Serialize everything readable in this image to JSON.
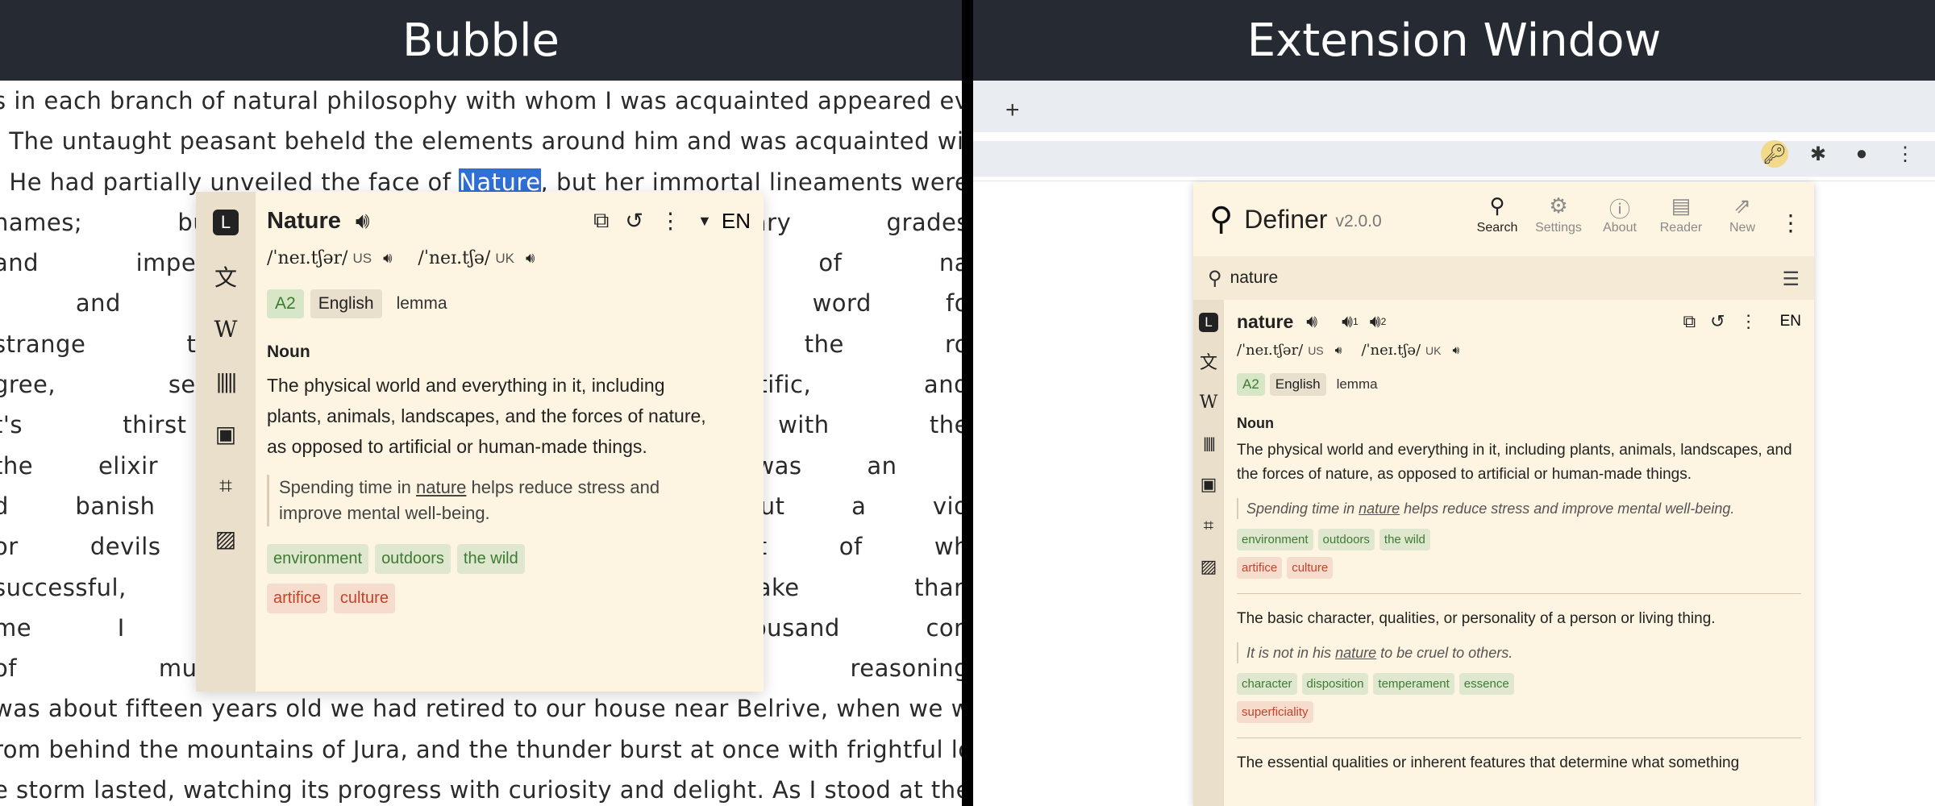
{
  "left_panel": {
    "title": "Bubble",
    "book_lines": [
      {
        "pre": "s in each branch of natural philosophy with whom I was acquainted appeared even",
        "word": "",
        "post": ""
      },
      {
        "pre": ". The untaught peasant beheld the elements around him and was acquainted with th",
        "word": "",
        "post": ""
      },
      {
        "pre": ". He had partially unveiled the face of ",
        "word": "Nature",
        "post": ", but her immortal lineaments were still"
      },
      {
        "pre": "names; but, not to",
        "word": "",
        "post": "                                                         nd tertiary grades"
      },
      {
        "pre": " and impediments",
        "word": "",
        "post": "                                                         g the citadel of na"
      },
      {
        "pre": ", and here were m",
        "word": "",
        "post": "                                                         took their word fo"
      },
      {
        "pre": "strange that such",
        "word": "",
        "post": "                                                         I followed the ro"
      },
      {
        "pre": "gree, self-taught w",
        "word": "",
        "post": "                                                         not scientific, and"
      },
      {
        "pre": "t's thirst for know",
        "word": "",
        "post": "                                                         entered with the"
      },
      {
        "pre": "the elixir of life; bu",
        "word": "",
        "post": "                                                         n. Wealth was an i"
      },
      {
        "pre": "d banish disease f",
        "word": "",
        "post": "                                                         le to any but a vid"
      },
      {
        "pre": "or devils was a pro",
        "word": "",
        "post": "                                                         he fulfilment of wh"
      },
      {
        "pre": "successful, I attrib",
        "word": "",
        "post": "                                                         and mistake than"
      },
      {
        "pre": "me I was occupie",
        "word": "",
        "post": "                                                         t, a thousand con"
      },
      {
        "pre": " of multifarious kn",
        "word": "",
        "post": "                                                         childish reasoning"
      },
      {
        "pre": " was about fifteen years old we had retired to our house near Belrive, when we w",
        "word": "",
        "post": ""
      },
      {
        "pre": "rom behind the mountains of Jura, and the thunder burst at once with frightful lou",
        "word": "",
        "post": ""
      },
      {
        "pre": "e storm lasted, watching its progress with curiosity and delight. As I stood at the doo",
        "word": "",
        "post": ""
      }
    ]
  },
  "bubble": {
    "word": "Nature",
    "lang_code": "EN",
    "pron_us": "/ˈneɪ.tʃər/",
    "region_us": "US",
    "pron_uk": "/ˈneɪ.tʃə/",
    "region_uk": "UK",
    "level": "A2",
    "language": "English",
    "form": "lemma",
    "pos": "Noun",
    "definition": "The physical world and everything in it, including plants, animals, landscapes, and the forces of nature, as opposed to artificial or human-made things.",
    "example_pre": "Spending time in ",
    "example_word": "nature",
    "example_post": " helps reduce stress and improve mental well-being.",
    "synonyms": [
      "environment",
      "outdoors",
      "the wild"
    ],
    "antonyms": [
      "artifice",
      "culture"
    ]
  },
  "right_panel": {
    "title": "Extension Window",
    "new_tab_label": "+",
    "popup": {
      "app_name": "Definer",
      "version": "v2.0.0",
      "nav": [
        {
          "label": "Search",
          "icon": "search-icon"
        },
        {
          "label": "Settings",
          "icon": "gear-icon"
        },
        {
          "label": "About",
          "icon": "info-icon"
        },
        {
          "label": "Reader",
          "icon": "pdf-icon"
        },
        {
          "label": "New",
          "icon": "external-link-icon"
        }
      ],
      "search_value": "nature",
      "word": "nature",
      "lang_code": "EN",
      "audio_1": "1",
      "audio_2": "2",
      "pron_us": "/ˈneɪ.tʃər/",
      "region_us": "US",
      "pron_uk": "/ˈneɪ.tʃə/",
      "region_uk": "UK",
      "level": "A2",
      "language": "English",
      "form": "lemma",
      "pos": "Noun",
      "sense1": {
        "definition": "The physical world and everything in it, including plants, animals, landscapes, and the forces of nature, as opposed to artificial or human-made things.",
        "example_pre": "Spending time in ",
        "example_word": "nature",
        "example_post": " helps reduce stress and improve mental well-being.",
        "synonyms": [
          "environment",
          "outdoors",
          "the wild"
        ],
        "antonyms": [
          "artifice",
          "culture"
        ]
      },
      "sense2": {
        "definition": "The basic character, qualities, or personality of a person or living thing.",
        "example_pre": "It is not in his ",
        "example_word": "nature",
        "example_post": " to be cruel to others.",
        "synonyms": [
          "character",
          "disposition",
          "temperament",
          "essence"
        ],
        "antonyms": [
          "superficiality"
        ]
      },
      "sense3_partial": "The essential qualities or inherent features that determine what something"
    }
  }
}
